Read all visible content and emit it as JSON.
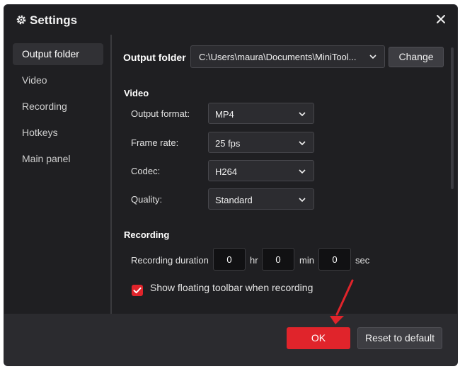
{
  "window": {
    "title": "Settings"
  },
  "sidebar": {
    "items": [
      {
        "label": "Output folder"
      },
      {
        "label": "Video"
      },
      {
        "label": "Recording"
      },
      {
        "label": "Hotkeys"
      },
      {
        "label": "Main panel"
      }
    ]
  },
  "output_folder": {
    "label": "Output folder",
    "path": "C:\\Users\\maura\\Documents\\MiniTool...",
    "change_label": "Change"
  },
  "video": {
    "heading": "Video",
    "output_format_label": "Output format:",
    "output_format_value": "MP4",
    "frame_rate_label": "Frame rate:",
    "frame_rate_value": "25 fps",
    "codec_label": "Codec:",
    "codec_value": "H264",
    "quality_label": "Quality:",
    "quality_value": "Standard"
  },
  "recording": {
    "heading": "Recording",
    "duration_label": "Recording duration",
    "hours": "0",
    "hours_unit": "hr",
    "minutes": "0",
    "minutes_unit": "min",
    "seconds": "0",
    "seconds_unit": "sec",
    "floating_toolbar_label": "Show floating toolbar when recording",
    "floating_toolbar_checked": true
  },
  "footer": {
    "ok_label": "OK",
    "reset_label": "Reset to default"
  },
  "colors": {
    "accent_red": "#e0242b",
    "background": "#1f1f22",
    "footer": "#2b2b2f"
  },
  "icons": {
    "title": "gear-icon",
    "close": "close-icon",
    "dropdown": "chevron-down-icon",
    "check": "check-icon",
    "annotation": "red-arrow-icon"
  }
}
